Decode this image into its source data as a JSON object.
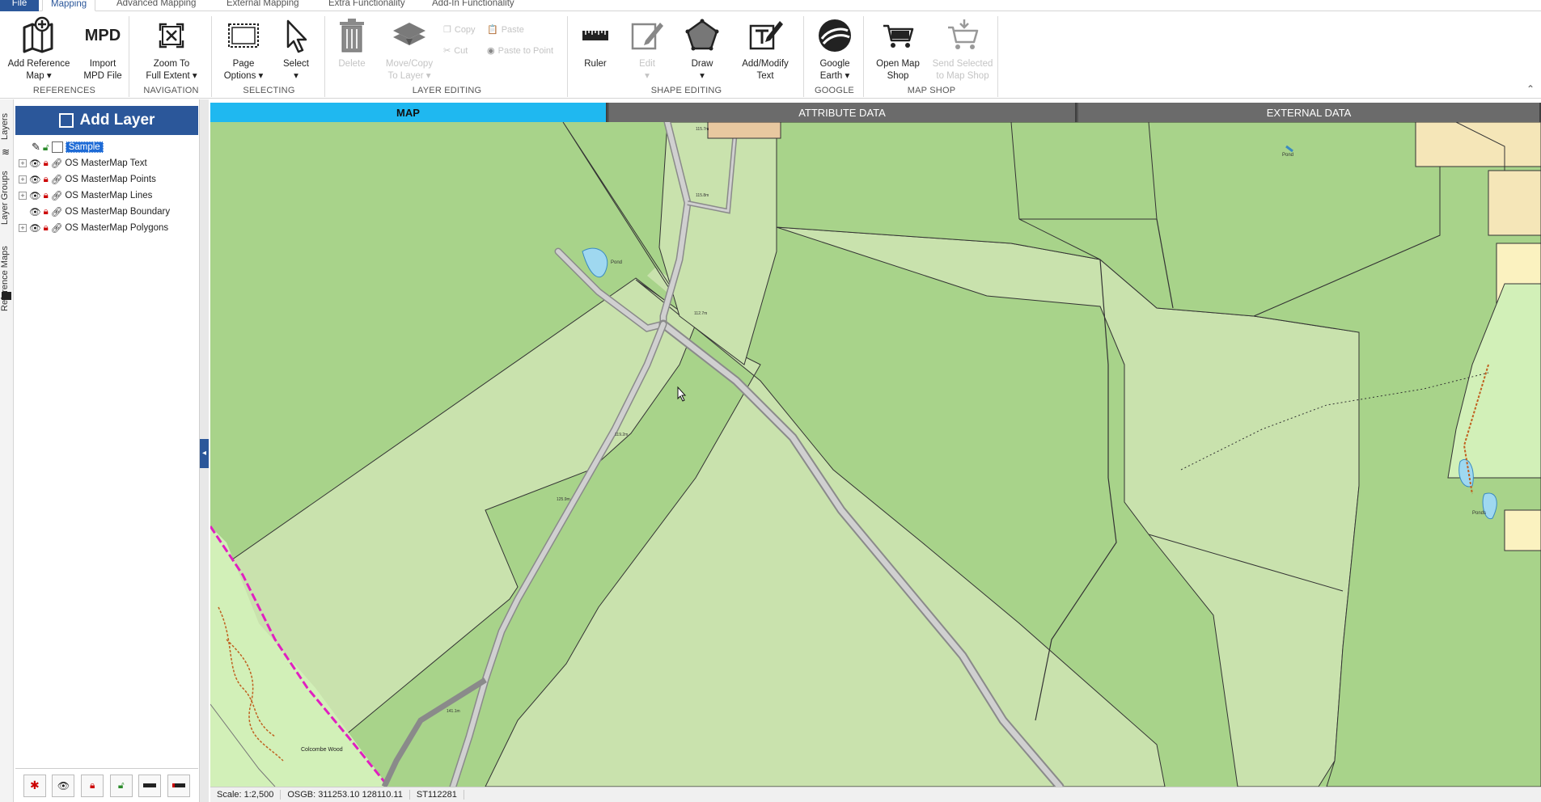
{
  "tabs": [
    "File",
    "Mapping",
    "Advanced Mapping",
    "External Mapping",
    "Extra Functionality",
    "Add-In Functionality"
  ],
  "ribbon": {
    "groups": {
      "references": "REFERENCES",
      "navigation": "NAVIGATION",
      "selecting": "SELECTING",
      "layer_editing": "LAYER EDITING",
      "shape_editing": "SHAPE EDITING",
      "google": "GOOGLE",
      "map_shop": "MAP SHOP"
    },
    "buttons": {
      "add_reference_map": [
        "Add Reference",
        "Map ▾"
      ],
      "import_mpd": [
        "Import",
        "MPD File"
      ],
      "mpd_icon": "MPD",
      "zoom_full": [
        "Zoom To",
        "Full Extent ▾"
      ],
      "page_options": [
        "Page",
        "Options ▾"
      ],
      "select": [
        "Select",
        "▾"
      ],
      "delete": [
        "Delete",
        ""
      ],
      "move_copy": [
        "Move/Copy",
        "To Layer ▾"
      ],
      "copy": "Copy",
      "paste": "Paste",
      "cut": "Cut",
      "paste_to_point": "Paste to Point",
      "ruler": [
        "Ruler",
        ""
      ],
      "edit": [
        "Edit",
        "▾"
      ],
      "draw": [
        "Draw",
        "▾"
      ],
      "add_modify_text": [
        "Add/Modify",
        "Text"
      ],
      "google_earth": [
        "Google",
        "Earth ▾"
      ],
      "open_map_shop": [
        "Open Map",
        "Shop"
      ],
      "send_selected": [
        "Send Selected",
        "to Map Shop"
      ]
    }
  },
  "side_tabs": [
    "Layers",
    "Layer Groups",
    "Reference Maps"
  ],
  "layer_panel": {
    "add_layer": "Add Layer",
    "selected_layer": "Sample",
    "layers": [
      {
        "name": "OS MasterMap Text",
        "expandable": true
      },
      {
        "name": "OS MasterMap Points",
        "expandable": true
      },
      {
        "name": "OS MasterMap Lines",
        "expandable": true
      },
      {
        "name": "OS MasterMap Boundary",
        "expandable": false
      },
      {
        "name": "OS MasterMap Polygons",
        "expandable": true
      }
    ]
  },
  "map_tabs": [
    "MAP",
    "ATTRIBUTE DATA",
    "EXTERNAL DATA"
  ],
  "map_labels": {
    "pond1": "Pond",
    "pond2": "Pond",
    "pond3": "Ponds",
    "wood": "Colcombe Wood",
    "spot1": "115.7m",
    "spot2": "115.8m",
    "spot3": "112.7m",
    "spot4": "119.2m",
    "spot5": "125.9m",
    "spot6": "141.1m"
  },
  "status": {
    "scale": "Scale: 1:2,500",
    "coords": "OSGB: 311253.10  128110.11",
    "grid": "ST112281"
  },
  "colors": {
    "ribbon_blue": "#2b579a",
    "active_map_tab": "#1fb8f0",
    "field_light": "#c9e2ad",
    "field_dark": "#a8d38a",
    "road": "#c8c8c8",
    "water": "#9fd8f0",
    "boundary_magenta": "#e020c0"
  }
}
